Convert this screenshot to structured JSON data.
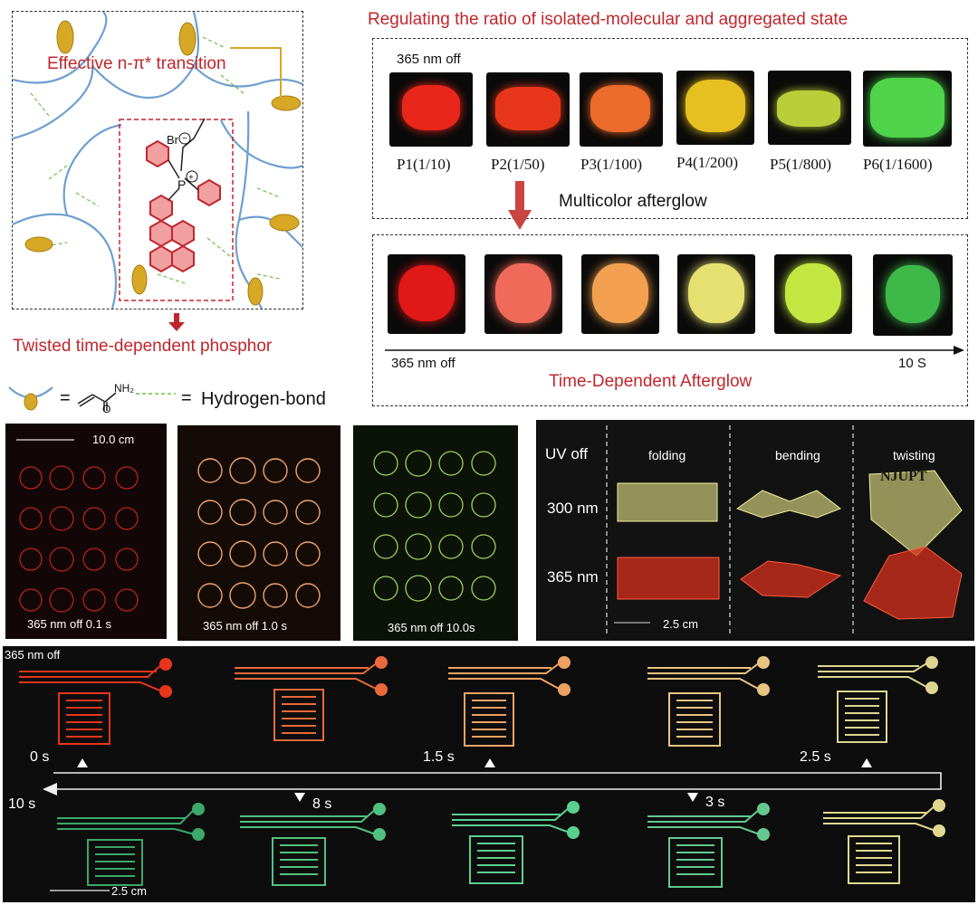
{
  "left_schematic": {
    "effective_label": "Effective n-π* transition",
    "twisted_label": "Twisted time-dependent phosphor",
    "legend_equals_1": "=",
    "legend_monomer_nh2": "NH₂",
    "legend_monomer_o": "O",
    "legend_equals_2": "=",
    "legend_hbond": "Hydrogen-bond",
    "molecule_br": "Br",
    "molecule_p": "P"
  },
  "ratio_panel": {
    "title": "Regulating the ratio of isolated-molecular and aggregated state",
    "off_label": "365 nm off",
    "samples": [
      {
        "label": "P1(1/10)",
        "color": "#e8261a"
      },
      {
        "label": "P2(1/50)",
        "color": "#e8361c"
      },
      {
        "label": "P3(1/100)",
        "color": "#ec6a2a"
      },
      {
        "label": "P4(1/200)",
        "color": "#e6c020"
      },
      {
        "label": "P5(1/800)",
        "color": "#b9cf3a"
      },
      {
        "label": "P6(1/1600)",
        "color": "#4ed34a"
      }
    ],
    "multicolor_label": "Multicolor afterglow"
  },
  "time_panel": {
    "start_label": "365 nm off",
    "end_label": "10 S",
    "title": "Time-Dependent Afterglow",
    "colors": [
      "#e01818",
      "#f06a5a",
      "#f2a050",
      "#e6e070",
      "#c4e640",
      "#3fb84a"
    ]
  },
  "patterns": {
    "scale": "10.0 cm",
    "photos": [
      {
        "caption": "365 nm off  0.1 s",
        "color": "#b52418"
      },
      {
        "caption": "365 nm off  1.0 s",
        "color": "#f2a36a"
      },
      {
        "caption": "365 nm off  10.0s",
        "color": "#9fd05a"
      }
    ]
  },
  "deform": {
    "uv_off": "UV off",
    "columns": [
      "folding",
      "bending",
      "twisting"
    ],
    "rows": [
      "300 nm",
      "365 nm"
    ],
    "scale": "2.5 cm",
    "mark_text": "NJUPT"
  },
  "circuit": {
    "off_label": "365 nm off",
    "times": {
      "t0": "0 s",
      "t15": "1.5 s",
      "t25": "2.5 s",
      "t3": "3 s",
      "t8": "8 s",
      "t10": "10 s"
    },
    "scale": "2.5 cm",
    "top_colors": [
      "#e8351c",
      "#e86a3a",
      "#eda264",
      "#e8c480",
      "#dcd690"
    ],
    "bottom_colors": [
      "#3ca86a",
      "#52c080",
      "#5ad090",
      "#64c890",
      "#e0d890"
    ]
  }
}
